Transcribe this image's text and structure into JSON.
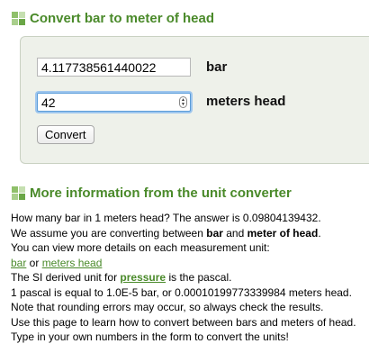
{
  "header": {
    "title": "Convert bar to meter of head",
    "icon": "grid-icon"
  },
  "converter": {
    "from_value": "4.117738561440022",
    "from_unit": "bar",
    "to_value": "42",
    "to_unit": "meters head",
    "button_label": "Convert"
  },
  "info": {
    "title": "More information from the unit converter",
    "icon": "grid-icon",
    "line1": "How many bar in 1 meters head? The answer is 0.09804139432.",
    "line2_prefix": "We assume you are converting between ",
    "line2_bar": "bar",
    "line2_and": " and ",
    "line2_head": "meter of head",
    "line2_suffix": ".",
    "line3": "You can view more details on each measurement unit:",
    "link_bar": "bar",
    "link_or": " or ",
    "link_head": "meters head",
    "line5_prefix": "The SI derived unit for ",
    "link_pressure": "pressure",
    "line5_suffix": " is the pascal.",
    "line6": "1 pascal is equal to 1.0E-5 bar, or 0.00010199773339984 meters head.",
    "line7": "Note that rounding errors may occur, so always check the results.",
    "line8": "Use this page to learn how to convert between bars and meters of head.",
    "line9": "Type in your own numbers in the form to convert the units!"
  },
  "colors": {
    "heading_green": "#4a8a2a",
    "box_background": "#eef1ea",
    "focus_blue": "#5b9dd9"
  }
}
